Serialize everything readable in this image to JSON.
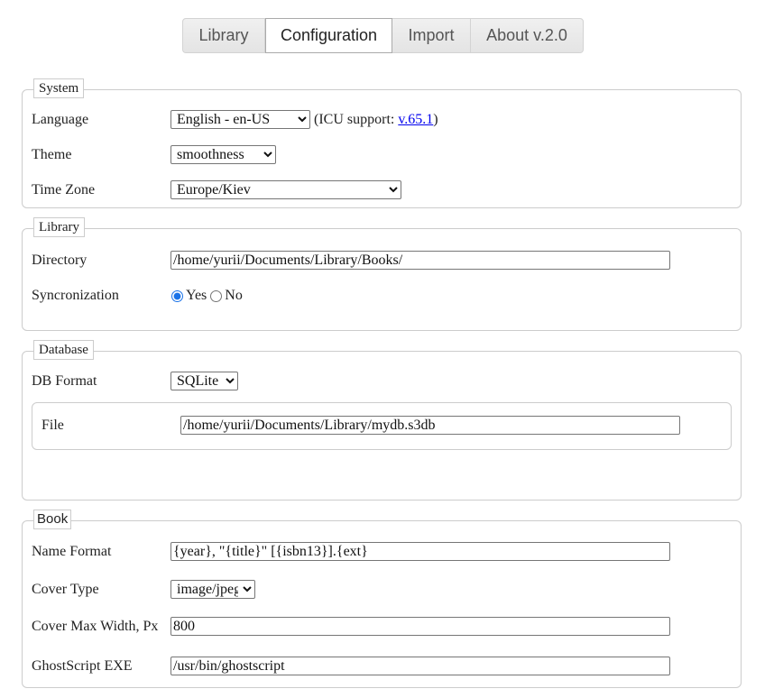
{
  "tabs": [
    {
      "label": "Library",
      "active": false
    },
    {
      "label": "Configuration",
      "active": true
    },
    {
      "label": "Import",
      "active": false
    },
    {
      "label": "About v.2.0",
      "active": false
    }
  ],
  "system": {
    "legend": "System",
    "language": {
      "label": "Language",
      "value": "English - en-US",
      "icu_prefix": "(ICU support: ",
      "icu_link": "v.65.1",
      "icu_suffix": ")"
    },
    "theme": {
      "label": "Theme",
      "value": "smoothness"
    },
    "timezone": {
      "label": "Time Zone",
      "value": "Europe/Kiev"
    }
  },
  "library": {
    "legend": "Library",
    "directory": {
      "label": "Directory",
      "value": "/home/yurii/Documents/Library/Books/"
    },
    "sync": {
      "label": "Syncronization",
      "yes": "Yes",
      "no": "No",
      "selected": "Yes"
    }
  },
  "database": {
    "legend": "Database",
    "format": {
      "label": "DB Format",
      "value": "SQLite"
    },
    "file": {
      "label": "File",
      "value": "/home/yurii/Documents/Library/mydb.s3db"
    }
  },
  "book": {
    "legend": "Book",
    "name_format": {
      "label": "Name Format",
      "value": "{year}, \"{title}\" [{isbn13}].{ext}"
    },
    "cover_type": {
      "label": "Cover Type",
      "value": "image/jpeg"
    },
    "cover_width": {
      "label": "Cover Max Width, Px",
      "value": "800"
    },
    "ghostscript": {
      "label": "GhostScript EXE",
      "value": "/usr/bin/ghostscript"
    }
  }
}
